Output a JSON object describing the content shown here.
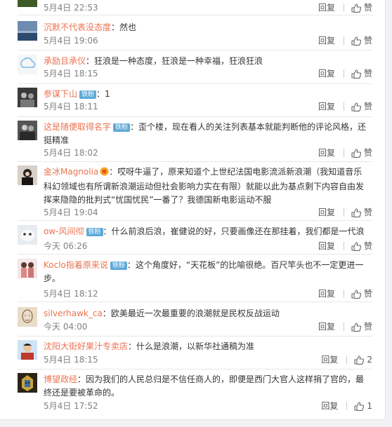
{
  "comments": [
    {
      "user": "",
      "badge": "",
      "gold": false,
      "text": "",
      "time": "5月4日 22:53",
      "reply": "回复",
      "like": "赞"
    },
    {
      "user": "沉默不代表没态度",
      "badge": "",
      "gold": false,
      "text": "：然也",
      "time": "5月4日 19:06",
      "reply": "回复",
      "like": "赞"
    },
    {
      "user": "承励且承仪",
      "badge": "",
      "gold": false,
      "text": "：狂浪是一种态度，狂浪是一种幸福，狂浪狂浪",
      "time": "5月4日 18:15",
      "reply": "回复",
      "like": "赞"
    },
    {
      "user": "参谋下山",
      "badge": "铁粉",
      "gold": false,
      "text": "：1",
      "time": "5月4日 18:11",
      "reply": "回复",
      "like": "赞"
    },
    {
      "user": "这是随便取得名字",
      "badge": "铁粉",
      "gold": false,
      "text": "：歪个楼，现在看人的关注列表基本就能判断他的评论风格，还挺精准",
      "time": "5月4日 18:02",
      "reply": "回复",
      "like": "赞"
    },
    {
      "user": "金冰Magnolia",
      "badge": "",
      "gold": true,
      "text": "：哎呀牛逼了，原来知道个上世纪法国电影流派新浪潮（我知道音乐科幻领域也有所谓新浪潮运动但社会影响力实在有限）就能以此为基点剩下内容自由发挥来隐隐的批判式“忧国忧民”一番了？我德国新电影运动不服",
      "time": "5月4日 19:04",
      "reply": "回复",
      "like": "赞"
    },
    {
      "user": "ow-风间彻",
      "badge": "铁粉",
      "gold": false,
      "text": "：什么前浪后浪，崔健说的好，只要画像还在那挂着，我们都是一代浪",
      "time": "今天 06:26",
      "reply": "回复",
      "like": "赞"
    },
    {
      "user": "Koclo指着原来说",
      "badge": "铁粉",
      "gold": false,
      "text": "：这个角度好，“天花板”的比喻很绝。百尺竿头也不一定更进一步。",
      "time": "5月4日 18:12",
      "reply": "回复",
      "like": "赞"
    },
    {
      "user": "silverhawk_ca",
      "badge": "",
      "gold": false,
      "text": "：欧美最近一次最重要的浪潮就是民权反战运动",
      "time": "今天 04:00",
      "reply": "回复",
      "like": "赞"
    },
    {
      "user": "沈阳大街好果汁专卖店",
      "badge": "",
      "gold": false,
      "text": "：什么是浪潮，以新华社通稿为准",
      "time": "5月4日 18:15",
      "reply": "回复",
      "like": "2"
    },
    {
      "user": "博望政经",
      "badge": "",
      "gold": false,
      "text": "：因为我们的人民总归是不信任商人的，即便是西门大官人这样捐了官的，最终还是要被革命的。",
      "time": "5月4日 17:52",
      "reply": "回复",
      "like": "1"
    }
  ]
}
